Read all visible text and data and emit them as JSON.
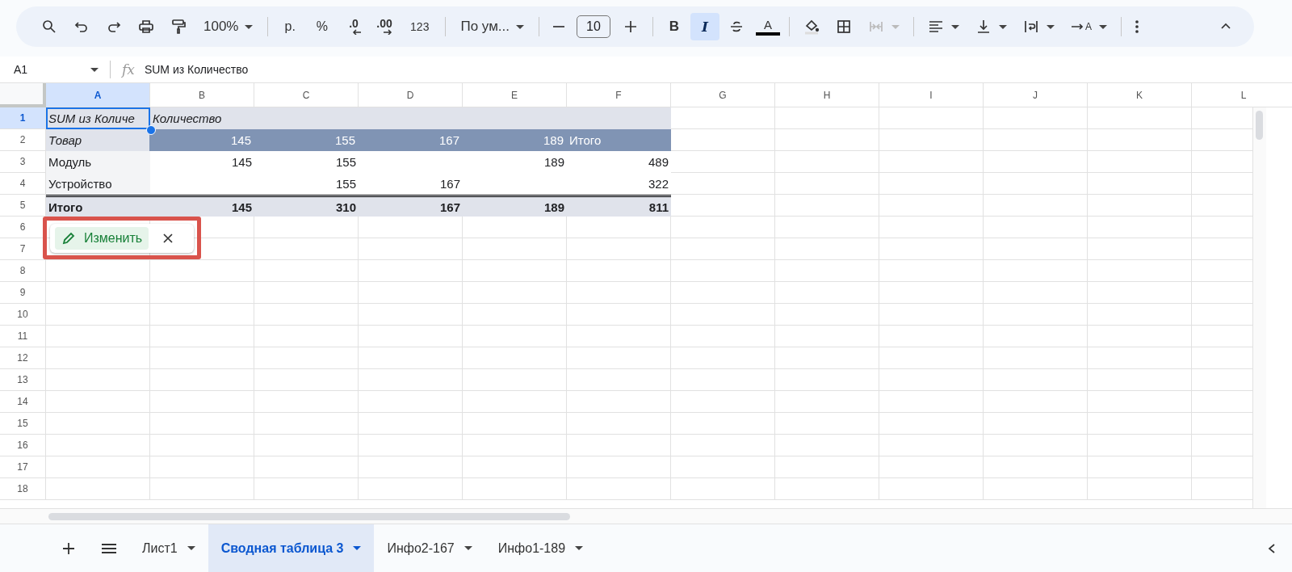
{
  "toolbar": [
    {
      "kind": "search"
    },
    {
      "kind": "undo"
    },
    {
      "kind": "redo"
    },
    {
      "kind": "print"
    },
    {
      "kind": "paint"
    },
    {
      "kind": "dropdown",
      "label": "100%"
    },
    {
      "kind": "sep"
    },
    {
      "kind": "text",
      "label": "р."
    },
    {
      "kind": "text",
      "label": "%"
    },
    {
      "kind": "decdown",
      "label": ".0"
    },
    {
      "kind": "decup",
      "label": ".00"
    },
    {
      "kind": "small",
      "label": "123"
    },
    {
      "kind": "sep"
    },
    {
      "kind": "dropdown",
      "label": "По ум..."
    },
    {
      "kind": "sep"
    },
    {
      "kind": "minus"
    },
    {
      "kind": "field",
      "label": "10"
    },
    {
      "kind": "plus"
    },
    {
      "kind": "sep"
    },
    {
      "kind": "bold",
      "label": "B",
      "selected": false
    },
    {
      "kind": "italic",
      "label": "I",
      "selected": true
    },
    {
      "kind": "strike",
      "selected": false
    },
    {
      "kind": "textcolor",
      "label": "A"
    },
    {
      "kind": "sep"
    },
    {
      "kind": "fill"
    },
    {
      "kind": "borders"
    },
    {
      "kind": "merge"
    },
    {
      "kind": "sep"
    },
    {
      "kind": "align"
    },
    {
      "kind": "valign"
    },
    {
      "kind": "wrap"
    },
    {
      "kind": "rotate",
      "label": "A"
    },
    {
      "kind": "sep"
    },
    {
      "kind": "more"
    }
  ],
  "name_box": "A1",
  "function_label": "fx",
  "formula": "SUM из Количество",
  "columns": [
    {
      "label": "A",
      "selected": true
    },
    {
      "label": "B",
      "selected": false
    },
    {
      "label": "C",
      "selected": false
    },
    {
      "label": "D",
      "selected": false
    },
    {
      "label": "E",
      "selected": false
    },
    {
      "label": "F",
      "selected": false
    },
    {
      "label": "G",
      "selected": false
    },
    {
      "label": "H",
      "selected": false
    },
    {
      "label": "I",
      "selected": false
    },
    {
      "label": "J",
      "selected": false
    },
    {
      "label": "K",
      "selected": false
    },
    {
      "label": "L",
      "selected": false
    }
  ],
  "rows": [
    {
      "label": "1",
      "selected": true
    },
    {
      "label": "2",
      "selected": false
    },
    {
      "label": "3",
      "selected": false
    },
    {
      "label": "4",
      "selected": false
    },
    {
      "label": "5",
      "selected": false
    },
    {
      "label": "6",
      "selected": false
    },
    {
      "label": "7",
      "selected": false
    },
    {
      "label": "8",
      "selected": false
    },
    {
      "label": "9",
      "selected": false
    },
    {
      "label": "10",
      "selected": false
    },
    {
      "label": "11",
      "selected": false
    },
    {
      "label": "12",
      "selected": false
    },
    {
      "label": "13",
      "selected": false
    },
    {
      "label": "14",
      "selected": false
    },
    {
      "label": "15",
      "selected": false
    },
    {
      "label": "16",
      "selected": false
    },
    {
      "label": "17",
      "selected": false
    },
    {
      "label": "18",
      "selected": false
    }
  ],
  "pivot": [
    {
      "kind": "title",
      "cells": [
        {
          "text": "SUM из Количе",
          "kind": "label"
        },
        {
          "text": "Количество",
          "kind": "label"
        },
        {
          "text": ""
        },
        {
          "text": ""
        },
        {
          "text": ""
        },
        {
          "text": ""
        }
      ]
    },
    {
      "kind": "header",
      "cells": [
        {
          "text": "Товар",
          "kind": "label"
        },
        {
          "text": "145",
          "kind": "number"
        },
        {
          "text": "155",
          "kind": "number"
        },
        {
          "text": "167",
          "kind": "number"
        },
        {
          "text": "189",
          "kind": "number"
        },
        {
          "text": "Итого",
          "kind": "label"
        }
      ]
    },
    {
      "kind": "data",
      "cells": [
        {
          "text": "Модуль",
          "kind": "label"
        },
        {
          "text": "145",
          "kind": "number"
        },
        {
          "text": "155",
          "kind": "number"
        },
        {
          "text": ""
        },
        {
          "text": "189",
          "kind": "number"
        },
        {
          "text": "489",
          "kind": "number"
        }
      ]
    },
    {
      "kind": "data",
      "cells": [
        {
          "text": "Устройство",
          "kind": "label"
        },
        {
          "text": ""
        },
        {
          "text": "155",
          "kind": "number"
        },
        {
          "text": "167",
          "kind": "number"
        },
        {
          "text": ""
        },
        {
          "text": "322",
          "kind": "number"
        }
      ]
    },
    {
      "kind": "total",
      "cells": [
        {
          "text": "Итого",
          "kind": "label"
        },
        {
          "text": "145",
          "kind": "number"
        },
        {
          "text": "310",
          "kind": "number"
        },
        {
          "text": "167",
          "kind": "number"
        },
        {
          "text": "189",
          "kind": "number"
        },
        {
          "text": "811",
          "kind": "number"
        }
      ]
    }
  ],
  "pivot_popup": {
    "edit_button": "Изменить"
  },
  "sheets": [
    {
      "label": "Лист1",
      "selected": false
    },
    {
      "label": "Сводная таблица 3",
      "selected": true
    },
    {
      "label": "Инфо2-167",
      "selected": false
    },
    {
      "label": "Инфо1-189",
      "selected": false
    }
  ]
}
